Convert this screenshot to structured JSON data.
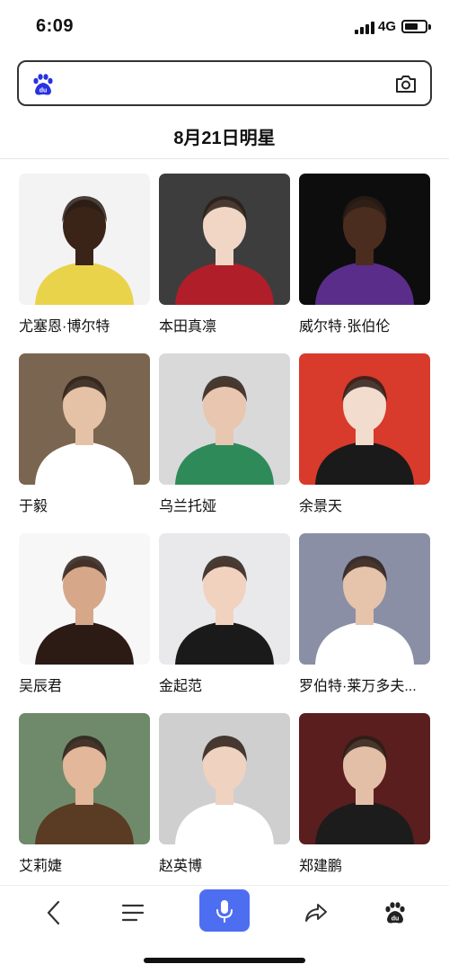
{
  "status_bar": {
    "time": "6:09",
    "network": "4G"
  },
  "search": {
    "value": "",
    "logo_icon": "baidu-paw-icon",
    "camera_icon": "camera-icon"
  },
  "page": {
    "title": "8月21日明星"
  },
  "celebrities": [
    {
      "name": "尤塞恩·博尔特",
      "photo_colors": [
        "#f3f3f3",
        "#3a2418",
        "#e9d34a"
      ]
    },
    {
      "name": "本田真凛",
      "photo_colors": [
        "#3d3d3d",
        "#f1d6c6",
        "#b01e2a"
      ]
    },
    {
      "name": "威尔特·张伯伦",
      "photo_colors": [
        "#0d0d0d",
        "#4a2d1f",
        "#5b2d8a"
      ]
    },
    {
      "name": "于毅",
      "photo_colors": [
        "#7a6650",
        "#e5c2a6",
        "#ffffff"
      ]
    },
    {
      "name": "乌兰托娅",
      "photo_colors": [
        "#d9d9d9",
        "#e9c6b0",
        "#2f8a5a"
      ]
    },
    {
      "name": "余景天",
      "photo_colors": [
        "#d83a2c",
        "#f2dccd",
        "#1a1a1a"
      ]
    },
    {
      "name": "吴辰君",
      "photo_colors": [
        "#f7f7f7",
        "#d7a78a",
        "#2b1b14"
      ]
    },
    {
      "name": "金起范",
      "photo_colors": [
        "#e9e9ec",
        "#f1d2bf",
        "#1a1a1a"
      ]
    },
    {
      "name": "罗伯特·莱万多夫...",
      "photo_colors": [
        "#8a8fa6",
        "#e6c3ab",
        "#ffffff"
      ]
    },
    {
      "name": "艾莉婕",
      "photo_colors": [
        "#6f8a6a",
        "#e2b79a",
        "#5a3b24"
      ]
    },
    {
      "name": "赵英博",
      "photo_colors": [
        "#cfcfcf",
        "#efd2c0",
        "#ffffff"
      ]
    },
    {
      "name": "郑建鹏",
      "photo_colors": [
        "#5a1e1e",
        "#e3bfa8",
        "#1c1c1c"
      ]
    }
  ],
  "bottom_nav": [
    {
      "icon": "back-icon"
    },
    {
      "icon": "menu-icon"
    },
    {
      "icon": "microphone-icon"
    },
    {
      "icon": "share-icon"
    },
    {
      "icon": "baidu-paw-icon"
    }
  ],
  "colors": {
    "accent": "#4e6ef2",
    "text": "#111111",
    "divider": "#e6e6e6"
  }
}
